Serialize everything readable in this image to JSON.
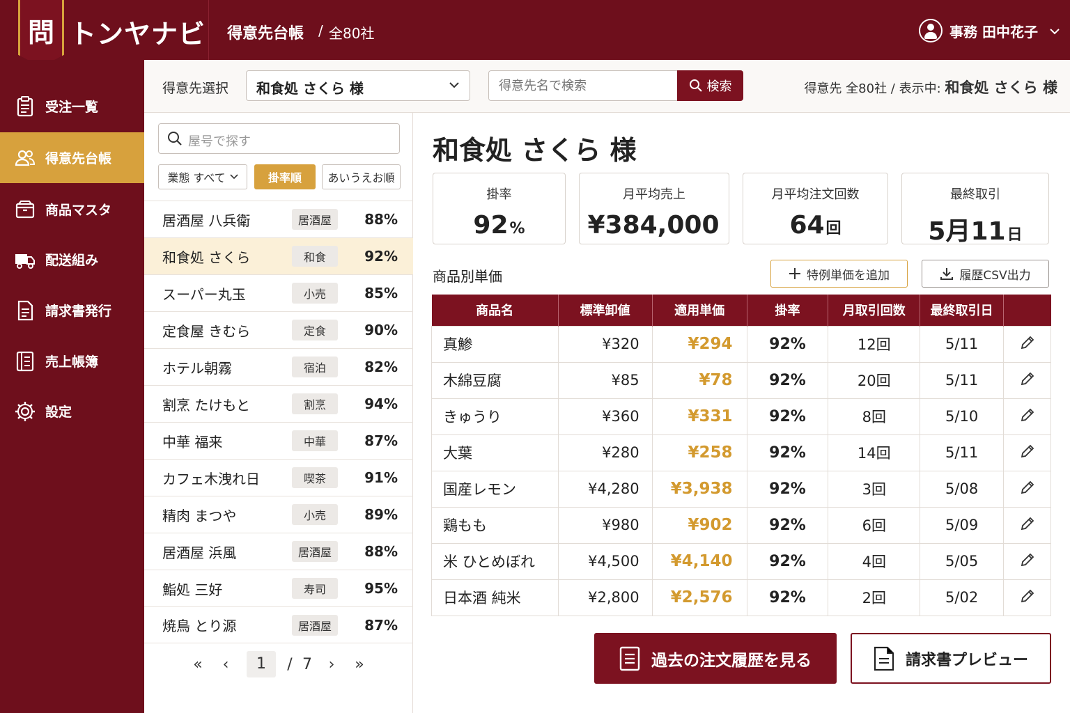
{
  "header": {
    "logo_char": "問",
    "app_name": "トンヤナビ",
    "page_title": "得意先台帳",
    "separator": "/",
    "total_count": "全80社",
    "user_name": "事務 田中花子"
  },
  "sidebar": {
    "items": [
      {
        "label": "受注一覧",
        "icon": "clipboard-icon",
        "active": false
      },
      {
        "label": "得意先台帳",
        "icon": "users-icon",
        "active": true
      },
      {
        "label": "商品マスタ",
        "icon": "box-icon",
        "active": false
      },
      {
        "label": "配送組み",
        "icon": "truck-icon",
        "active": false
      },
      {
        "label": "請求書発行",
        "icon": "invoice-icon",
        "active": false
      },
      {
        "label": "売上帳簿",
        "icon": "ledger-icon",
        "active": false
      },
      {
        "label": "設定",
        "icon": "gear-icon",
        "active": false
      }
    ]
  },
  "filterbar": {
    "label": "得意先選択",
    "selected": "和食処 さくら 様",
    "search_placeholder": "得意先名で検索",
    "search_button": "検索",
    "status_prefix": "得意先 全80社 / 表示中:",
    "status_current": "和食処 さくら 様"
  },
  "list": {
    "search_placeholder": "屋号で探す",
    "chips": [
      "業態 すべて",
      "掛率順",
      "あいうえお順"
    ],
    "rows": [
      {
        "name": "居酒屋 八兵衛",
        "tag": "居酒屋",
        "rate": "88%"
      },
      {
        "name": "和食処 さくら",
        "tag": "和食",
        "rate": "92%"
      },
      {
        "name": "スーパー丸玉",
        "tag": "小売",
        "rate": "85%"
      },
      {
        "name": "定食屋 きむら",
        "tag": "定食",
        "rate": "90%"
      },
      {
        "name": "ホテル朝霧",
        "tag": "宿泊",
        "rate": "82%"
      },
      {
        "name": "割烹 たけもと",
        "tag": "割烹",
        "rate": "94%"
      },
      {
        "name": "中華 福来",
        "tag": "中華",
        "rate": "87%"
      },
      {
        "name": "カフェ木洩れ日",
        "tag": "喫茶",
        "rate": "91%"
      },
      {
        "name": "精肉 まつや",
        "tag": "小売",
        "rate": "89%"
      },
      {
        "name": "居酒屋 浜風",
        "tag": "居酒屋",
        "rate": "88%"
      },
      {
        "name": "鮨処 三好",
        "tag": "寿司",
        "rate": "95%"
      },
      {
        "name": "焼鳥 とり源",
        "tag": "居酒屋",
        "rate": "87%"
      }
    ],
    "pager": {
      "current": "1",
      "separator": "/",
      "total": "7"
    }
  },
  "detail": {
    "title": "和食処 さくら 様",
    "stats": [
      {
        "label": "掛率",
        "value": "92",
        "unit": "%"
      },
      {
        "label": "月平均売上",
        "value": "¥384,000",
        "unit": ""
      },
      {
        "label": "月平均注文回数",
        "value": "64",
        "unit": "回"
      },
      {
        "label": "最終取引",
        "value": "5月11",
        "unit": "日"
      }
    ],
    "section_title": "商品別単価",
    "add_button": "特例単価を追加",
    "csv_button": "履歴CSV出力",
    "table": {
      "headers": [
        "商品名",
        "標準卸値",
        "適用単価",
        "掛率",
        "月取引回数",
        "最終取引日"
      ],
      "rows": [
        {
          "name": "真鯵",
          "std": "¥320",
          "applied": "¥294",
          "rate": "92%",
          "count": "12回",
          "date": "5/11"
        },
        {
          "name": "木綿豆腐",
          "std": "¥85",
          "applied": "¥78",
          "rate": "92%",
          "count": "20回",
          "date": "5/11"
        },
        {
          "name": "きゅうり",
          "std": "¥360",
          "applied": "¥331",
          "rate": "92%",
          "count": "8回",
          "date": "5/10"
        },
        {
          "name": "大葉",
          "std": "¥280",
          "applied": "¥258",
          "rate": "92%",
          "count": "14回",
          "date": "5/11"
        },
        {
          "name": "国産レモン",
          "std": "¥4,280",
          "applied": "¥3,938",
          "rate": "92%",
          "count": "3回",
          "date": "5/08"
        },
        {
          "name": "鶏もも",
          "std": "¥980",
          "applied": "¥902",
          "rate": "92%",
          "count": "6回",
          "date": "5/09"
        },
        {
          "name": "米 ひとめぼれ",
          "std": "¥4,500",
          "applied": "¥4,140",
          "rate": "92%",
          "count": "4回",
          "date": "5/05"
        },
        {
          "name": "日本酒 純米",
          "std": "¥2,800",
          "applied": "¥2,576",
          "rate": "92%",
          "count": "2回",
          "date": "5/02"
        }
      ]
    },
    "history_button": "過去の注文履歴を見る",
    "invoice_button": "請求書プレビュー"
  },
  "colors": {
    "brand": "#6e0f1c",
    "accent": "#d7a13d",
    "header_row": "#7c1220"
  }
}
